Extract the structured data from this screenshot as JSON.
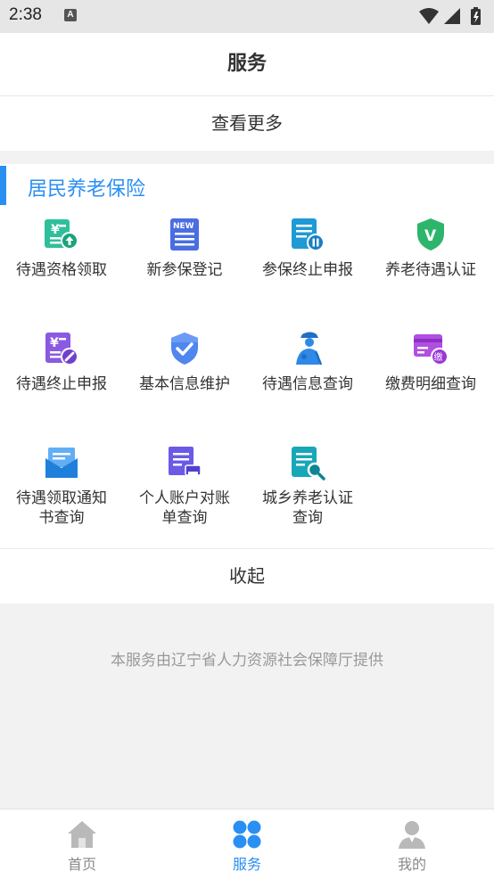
{
  "status": {
    "time": "2:38",
    "notif_icon": "A"
  },
  "header": {
    "title": "服务"
  },
  "more": {
    "label": "查看更多"
  },
  "section": {
    "title": "居民养老保险",
    "accent": "#2a8ff3",
    "items": [
      {
        "label": "待遇资格领取",
        "icon": "yuan-upload-icon"
      },
      {
        "label": "新参保登记",
        "icon": "new-doc-icon",
        "badge": "NEW"
      },
      {
        "label": "参保终止申报",
        "icon": "doc-pause-icon"
      },
      {
        "label": "养老待遇认证",
        "icon": "shield-v-icon",
        "badge": "V"
      },
      {
        "label": "待遇终止申报",
        "icon": "yuan-cancel-icon"
      },
      {
        "label": "基本信息维护",
        "icon": "shield-check-icon"
      },
      {
        "label": "待遇信息查询",
        "icon": "elderly-person-icon"
      },
      {
        "label": "缴费明细查询",
        "icon": "card-pay-icon",
        "badge": "缴"
      },
      {
        "label": "待遇领取通知书查询",
        "icon": "envelope-icon"
      },
      {
        "label": "个人账户对账单查询",
        "icon": "doc-print-icon"
      },
      {
        "label": "城乡养老认证查询",
        "icon": "doc-search-icon"
      }
    ]
  },
  "collapse": {
    "label": "收起"
  },
  "footer": {
    "note": "本服务由辽宁省人力资源社会保障厅提供"
  },
  "tabs": [
    {
      "label": "首页",
      "icon": "home-icon"
    },
    {
      "label": "服务",
      "icon": "clover-icon",
      "active": true
    },
    {
      "label": "我的",
      "icon": "user-icon"
    }
  ]
}
